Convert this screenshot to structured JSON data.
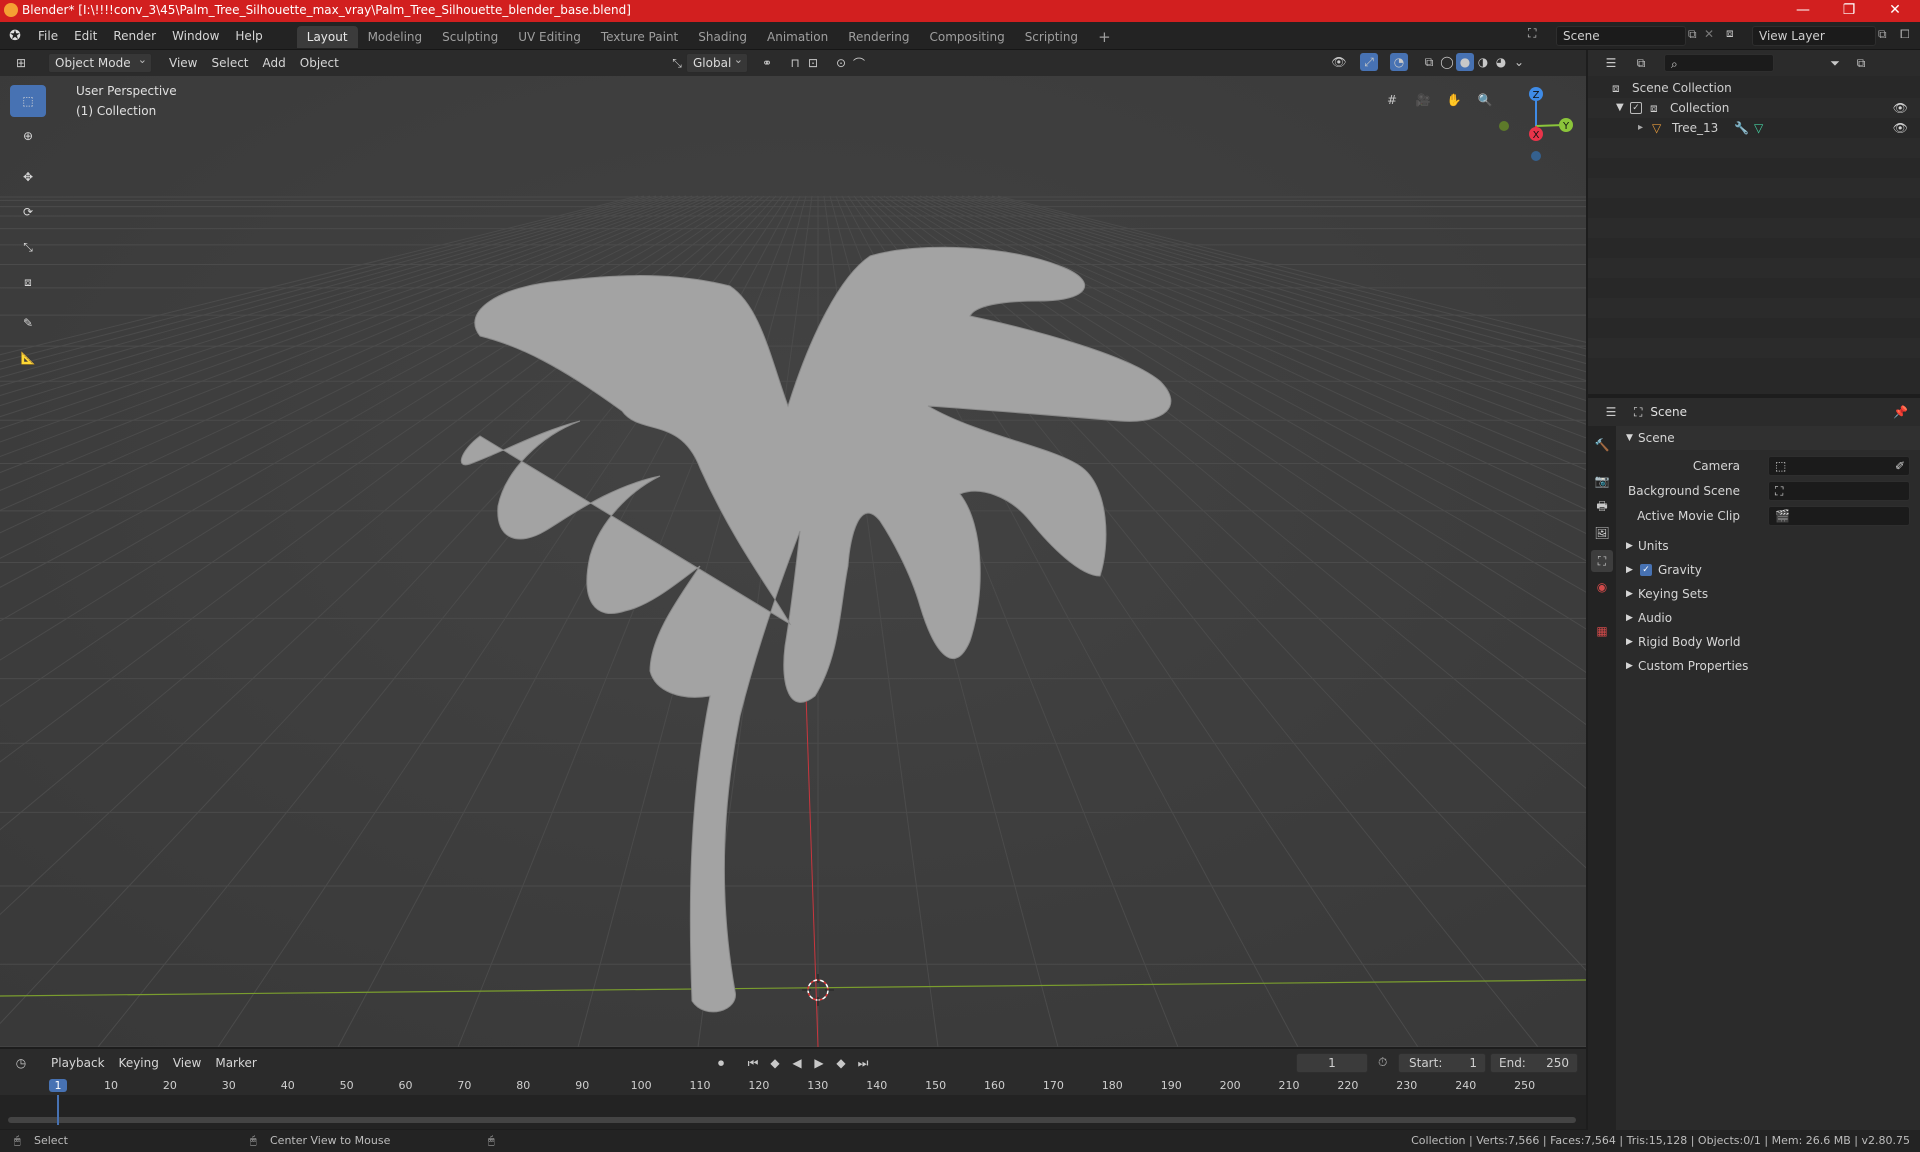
{
  "window": {
    "title": "Blender* [I:\\!!!!conv_3\\45\\Palm_Tree_Silhouette_max_vray\\Palm_Tree_Silhouette_blender_base.blend]",
    "minimize": "—",
    "maximize": "❐",
    "close": "✕"
  },
  "menu": {
    "items": [
      "File",
      "Edit",
      "Render",
      "Window",
      "Help"
    ]
  },
  "workspaces": {
    "tabs": [
      "Layout",
      "Modeling",
      "Sculpting",
      "UV Editing",
      "Texture Paint",
      "Shading",
      "Animation",
      "Rendering",
      "Compositing",
      "Scripting"
    ],
    "add": "+",
    "active": "Layout"
  },
  "scene_field": {
    "value": "Scene"
  },
  "view_layer_field": {
    "value": "View Layer"
  },
  "viewport_header": {
    "mode": "Object Mode",
    "menus": [
      "View",
      "Select",
      "Add",
      "Object"
    ],
    "orientation": "Global"
  },
  "viewport": {
    "perspective": "User Perspective",
    "collection": "(1) Collection",
    "gizmo": {
      "z": "Z",
      "y": "Y",
      "x": "X"
    }
  },
  "outliner": {
    "scene_collection": "Scene Collection",
    "collection": "Collection",
    "object": "Tree_13"
  },
  "properties": {
    "header": "Scene",
    "panel_title": "Scene",
    "camera_label": "Camera",
    "bg_scene_label": "Background Scene",
    "movie_clip_label": "Active Movie Clip",
    "sections": [
      "Units",
      "Gravity",
      "Keying Sets",
      "Audio",
      "Rigid Body World",
      "Custom Properties"
    ]
  },
  "timeline": {
    "menus": [
      "Playback",
      "Keying",
      "View",
      "Marker"
    ],
    "current_frame": "1",
    "start_label": "Start:",
    "start_value": "1",
    "end_label": "End:",
    "end_value": "250",
    "ruler": [
      "1",
      "10",
      "20",
      "30",
      "40",
      "50",
      "60",
      "70",
      "80",
      "90",
      "100",
      "110",
      "120",
      "130",
      "140",
      "150",
      "160",
      "170",
      "180",
      "190",
      "200",
      "210",
      "220",
      "230",
      "240",
      "250"
    ]
  },
  "statusbar": {
    "select": "Select",
    "center": "Center View to Mouse",
    "stats": "Collection | Verts:7,566 | Faces:7,564 | Tris:15,128 | Objects:0/1 | Mem: 26.6 MB | v2.80.75"
  },
  "colors": {
    "title_bar": "#d21f1f",
    "accent": "#4772b3",
    "x_axis": "#e8344a",
    "y_axis": "#8bc53a",
    "z_axis": "#3f8be6"
  }
}
